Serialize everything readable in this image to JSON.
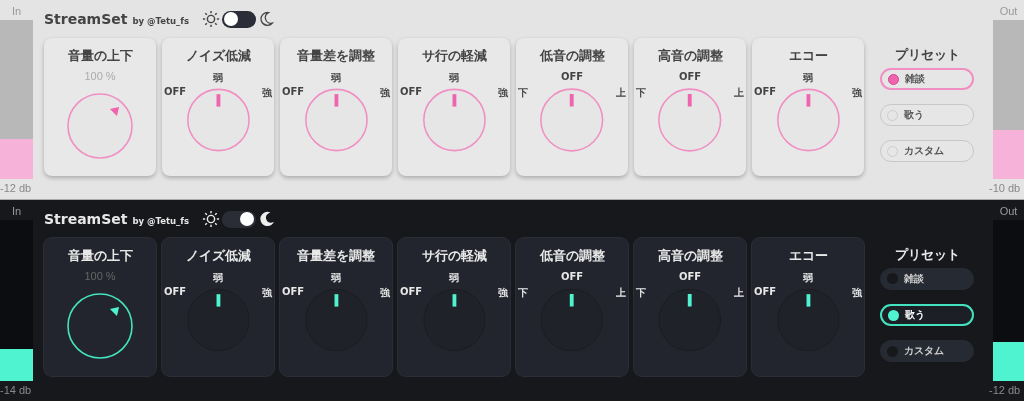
{
  "panels": [
    {
      "dark_mode": false,
      "title": "StreamSet",
      "byline": "by @Tetu_fs",
      "meter_in": {
        "label": "In",
        "level": 0.25,
        "reading": "-12 db"
      },
      "meter_out": {
        "label": "Out",
        "level": 0.31,
        "reading": "-10 db"
      },
      "knobs": [
        {
          "kind": "volume",
          "title": "音量の上下",
          "readout": "100 %"
        },
        {
          "kind": "dial",
          "title": "ノイズ低減",
          "left": "OFF",
          "top": "弱",
          "right": "強"
        },
        {
          "kind": "dial",
          "title": "音量差を調整",
          "left": "OFF",
          "top": "弱",
          "right": "強"
        },
        {
          "kind": "dial",
          "title": "サ行の軽減",
          "left": "OFF",
          "top": "弱",
          "right": "強"
        },
        {
          "kind": "dial",
          "title": "低音の調整",
          "left": "下",
          "top": "OFF",
          "right": "上"
        },
        {
          "kind": "dial",
          "title": "高音の調整",
          "left": "下",
          "top": "OFF",
          "right": "上"
        },
        {
          "kind": "dial",
          "title": "エコー",
          "left": "OFF",
          "top": "弱",
          "right": "強"
        }
      ],
      "preset": {
        "title": "プリセット",
        "options": [
          {
            "label": "雑談",
            "selected": true
          },
          {
            "label": "歌う",
            "selected": false
          },
          {
            "label": "カスタム",
            "selected": false
          }
        ]
      }
    },
    {
      "dark_mode": true,
      "title": "StreamSet",
      "byline": "by @Tetu_fs",
      "meter_in": {
        "label": "In",
        "level": 0.2,
        "reading": "-14 db"
      },
      "meter_out": {
        "label": "Out",
        "level": 0.24,
        "reading": "-12 db"
      },
      "knobs": [
        {
          "kind": "volume",
          "title": "音量の上下",
          "readout": "100 %"
        },
        {
          "kind": "dial",
          "title": "ノイズ低減",
          "left": "OFF",
          "top": "弱",
          "right": "強"
        },
        {
          "kind": "dial",
          "title": "音量差を調整",
          "left": "OFF",
          "top": "弱",
          "right": "強"
        },
        {
          "kind": "dial",
          "title": "サ行の軽減",
          "left": "OFF",
          "top": "弱",
          "right": "強"
        },
        {
          "kind": "dial",
          "title": "低音の調整",
          "left": "下",
          "top": "OFF",
          "right": "上"
        },
        {
          "kind": "dial",
          "title": "高音の調整",
          "left": "下",
          "top": "OFF",
          "right": "上"
        },
        {
          "kind": "dial",
          "title": "エコー",
          "left": "OFF",
          "top": "弱",
          "right": "強"
        }
      ],
      "preset": {
        "title": "プリセット",
        "options": [
          {
            "label": "雑談",
            "selected": false
          },
          {
            "label": "歌う",
            "selected": true
          },
          {
            "label": "カスタム",
            "selected": false
          }
        ]
      }
    }
  ]
}
